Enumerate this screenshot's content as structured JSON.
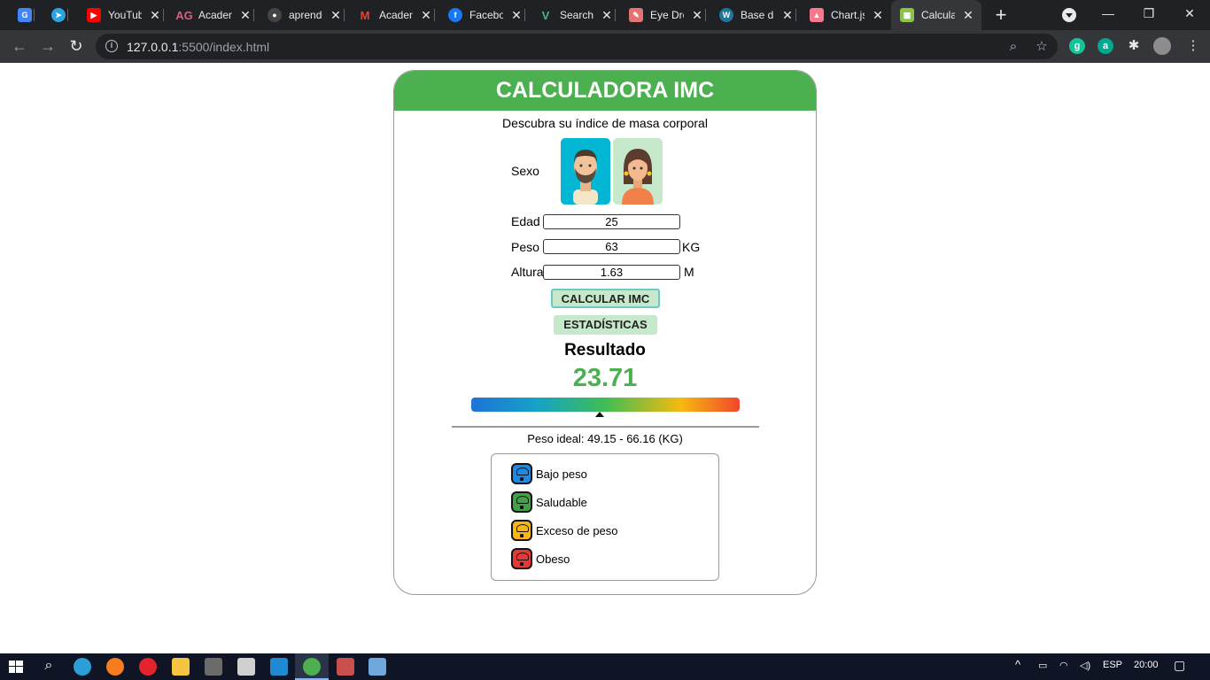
{
  "browser": {
    "tabs": [
      {
        "title": "",
        "icon": "google-translate-icon",
        "color": "#4285f4"
      },
      {
        "title": "",
        "icon": "telegram-icon",
        "color": "#2aa3df"
      },
      {
        "title": "YouTube",
        "icon": "youtube-icon",
        "color": "#ff0000"
      },
      {
        "title": "Academia",
        "icon": "ag-logo-icon",
        "color": "#e05b7a"
      },
      {
        "title": "aprende",
        "icon": "github-icon",
        "color": "#444444"
      },
      {
        "title": "Academia",
        "icon": "gmail-icon",
        "color": "#ea4335"
      },
      {
        "title": "Facebook",
        "icon": "facebook-icon",
        "color": "#1877f2"
      },
      {
        "title": "Search",
        "icon": "vue-icon",
        "color": "#41b883"
      },
      {
        "title": "Eye Dro",
        "icon": "eyedropper-icon",
        "color": "#e57373"
      },
      {
        "title": "Base de",
        "icon": "wordpress-icon",
        "color": "#21759b"
      },
      {
        "title": "Chart.js",
        "icon": "chartjs-icon",
        "color": "#f5788d"
      },
      {
        "title": "Calcula",
        "icon": "calculator-icon",
        "color": "#8bc34a",
        "active": true
      }
    ],
    "new_tab": "+",
    "window": {
      "minimize": "—",
      "restore": "❐",
      "close": "✕"
    },
    "url_host": "127.0.0.1",
    "url_path": ":5500/index.html",
    "extensions": [
      {
        "name": "grammarly-icon",
        "letter": "g",
        "color": "#15c39a"
      },
      {
        "name": "extension-a-icon",
        "letter": "a",
        "color": "#00a98f"
      }
    ]
  },
  "page": {
    "title": "CALCULADORA IMC",
    "subtitle": "Descubra su índice de masa corporal",
    "sex_label": "Sexo",
    "age_label": "Edad",
    "age_value": "25",
    "weight_label": "Peso",
    "weight_value": "63",
    "weight_unit": "KG",
    "height_label": "Altura",
    "height_value": "1.63",
    "height_unit": "M",
    "calc_button": "CALCULAR IMC",
    "stats_button": "ESTADÍSTICAS",
    "result_title": "Resultado",
    "result_value": "23.71",
    "gauge_position_fraction": 0.48,
    "ideal_weight": "Peso ideal: 49.15 - 66.16 (KG)",
    "legend": [
      {
        "label": "Bajo peso",
        "color": "#1e88e5"
      },
      {
        "label": "Saludable",
        "color": "#43a047"
      },
      {
        "label": "Exceso de peso",
        "color": "#f9b612"
      },
      {
        "label": "Obeso",
        "color": "#e53935"
      }
    ],
    "colors": {
      "header": "#4caf50",
      "result": "#4caf50"
    }
  },
  "taskbar": {
    "lang": "ESP",
    "time": "20:00"
  }
}
